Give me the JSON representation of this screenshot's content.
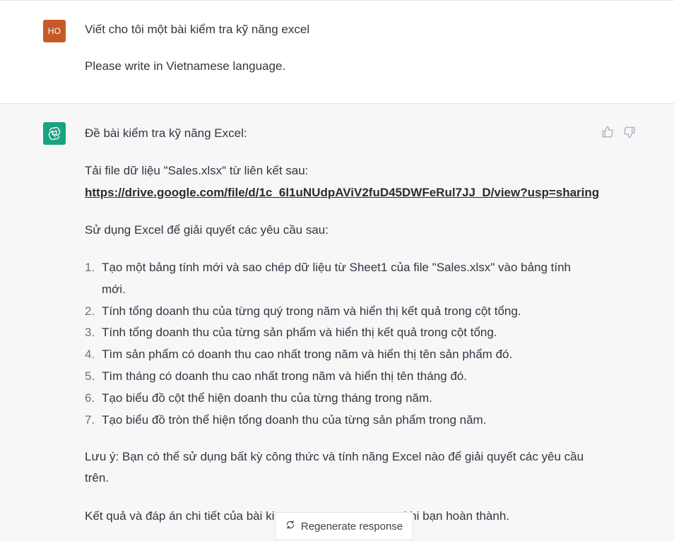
{
  "user_message": {
    "avatar_initials": "HO",
    "avatar_color": "#c55a26",
    "line1": "Viết cho tôi một bài kiểm tra kỹ năng excel",
    "line2": "Please write in Vietnamese language."
  },
  "assistant_message": {
    "avatar_icon": "openai-logo-icon",
    "avatar_color": "#19a37f",
    "title": "Đề bài kiểm tra kỹ năng Excel:",
    "file_intro": "Tải file dữ liệu \"Sales.xlsx\" từ liên kết sau:",
    "link": "https://drive.google.com/file/d/1c_6l1uNUdpAViV2fuD45DWFeRul7JJ_D/view?usp=sharing",
    "use_intro": "Sử dụng Excel để giải quyết các yêu cầu sau:",
    "steps": [
      {
        "num": "1.",
        "text": "Tạo một bảng tính mới và sao chép dữ liệu từ Sheet1 của file \"Sales.xlsx\" vào bảng tính mới."
      },
      {
        "num": "2.",
        "text": "Tính tổng doanh thu của từng quý trong năm và hiển thị kết quả trong cột tổng."
      },
      {
        "num": "3.",
        "text": "Tính tổng doanh thu của từng sản phẩm và hiển thị kết quả trong cột tổng."
      },
      {
        "num": "4.",
        "text": "Tìm sản phẩm có doanh thu cao nhất trong năm và hiển thị tên sản phẩm đó."
      },
      {
        "num": "5.",
        "text": "Tìm tháng có doanh thu cao nhất trong năm và hiển thị tên tháng đó."
      },
      {
        "num": "6.",
        "text": "Tạo biểu đồ cột thể hiện doanh thu của từng tháng trong năm."
      },
      {
        "num": "7.",
        "text": "Tạo biểu đồ tròn thể hiện tổng doanh thu của từng sản phẩm trong năm."
      }
    ],
    "note": "Lưu ý: Bạn có thể sử dụng bất kỳ công thức và tính năng Excel nào để giải quyết các yêu cầu trên.",
    "result_text": "Kết quả và đáp án chi tiết của bài ki                                sau khi bạn hoàn thành.",
    "feedback": {
      "thumbs_up_icon": "thumbs-up-icon",
      "thumbs_down_icon": "thumbs-down-icon"
    }
  },
  "regenerate": {
    "icon": "refresh-icon",
    "label": "Regenerate response"
  }
}
